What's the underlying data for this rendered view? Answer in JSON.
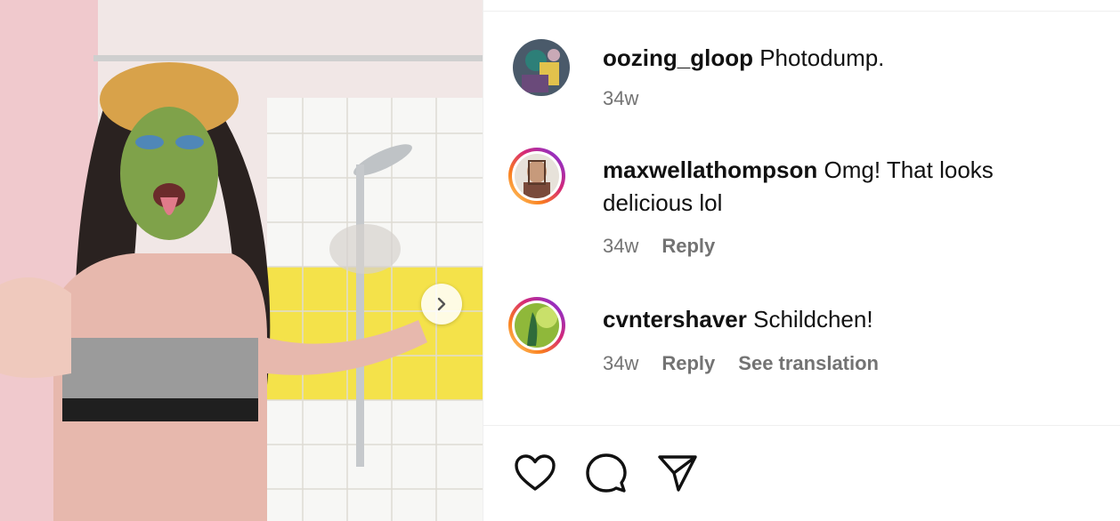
{
  "carousel": {
    "next_icon": "chevron-right-icon"
  },
  "comments": [
    {
      "username": "oozing_gloop",
      "text": "Photodump.",
      "time": "34w",
      "avatar_ring": false
    },
    {
      "username": "maxwellathompson",
      "text": "Omg! That looks delicious lol",
      "time": "34w",
      "reply_label": "Reply",
      "avatar_ring": true
    },
    {
      "username": "cvntershaver",
      "text": "Schildchen!",
      "time": "34w",
      "reply_label": "Reply",
      "translate_label": "See translation",
      "avatar_ring": true
    }
  ],
  "actions": {
    "like_icon": "heart-icon",
    "comment_icon": "comment-icon",
    "share_icon": "send-icon"
  },
  "colors": {
    "meta_text": "#737373",
    "story_ring": "#d62976"
  }
}
